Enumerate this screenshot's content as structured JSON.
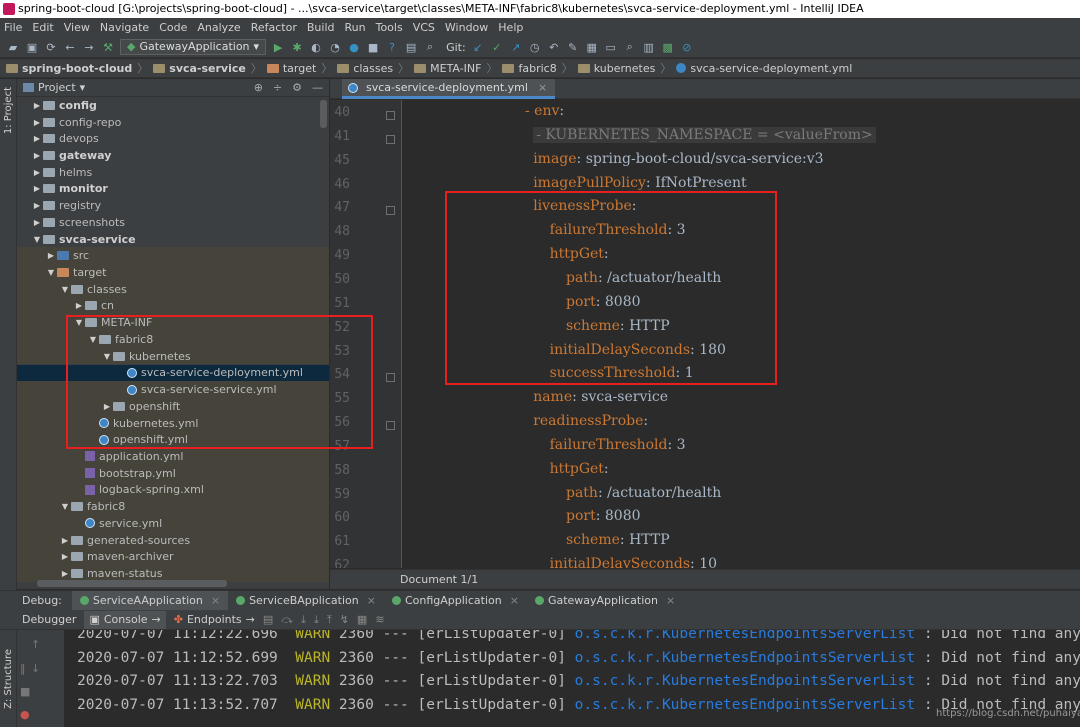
{
  "window": {
    "title": "spring-boot-cloud [G:\\projects\\spring-boot-cloud] - ...\\svca-service\\target\\classes\\META-INF\\fabric8\\kubernetes\\svca-service-deployment.yml - IntelliJ IDEA"
  },
  "menu": [
    "File",
    "Edit",
    "View",
    "Navigate",
    "Code",
    "Analyze",
    "Refactor",
    "Build",
    "Run",
    "Tools",
    "VCS",
    "Window",
    "Help"
  ],
  "toolbar": {
    "run_config": "GatewayApplication",
    "git_label": "Git:"
  },
  "breadcrumbs": [
    "spring-boot-cloud",
    "svca-service",
    "target",
    "classes",
    "META-INF",
    "fabric8",
    "kubernetes",
    "svca-service-deployment.yml"
  ],
  "side_strip": {
    "project": "1: Project",
    "structure": "Z: Structure"
  },
  "project_panel": {
    "title": "Project",
    "tree": [
      {
        "label": "config",
        "bold": true
      },
      {
        "label": "config-repo"
      },
      {
        "label": "devops"
      },
      {
        "label": "gateway",
        "bold": true
      },
      {
        "label": "helms"
      },
      {
        "label": "monitor",
        "bold": true
      },
      {
        "label": "registry"
      },
      {
        "label": "screenshots"
      },
      {
        "label": "svca-service",
        "bold": true
      },
      {
        "label": "src"
      },
      {
        "label": "target"
      },
      {
        "label": "classes"
      },
      {
        "label": "cn"
      },
      {
        "label": "META-INF"
      },
      {
        "label": "fabric8"
      },
      {
        "label": "kubernetes"
      },
      {
        "label": "svca-service-deployment.yml"
      },
      {
        "label": "svca-service-service.yml"
      },
      {
        "label": "openshift"
      },
      {
        "label": "kubernetes.yml"
      },
      {
        "label": "openshift.yml"
      },
      {
        "label": "application.yml"
      },
      {
        "label": "bootstrap.yml"
      },
      {
        "label": "logback-spring.xml"
      },
      {
        "label": "fabric8"
      },
      {
        "label": "service.yml"
      },
      {
        "label": "generated-sources"
      },
      {
        "label": "maven-archiver"
      },
      {
        "label": "maven-status"
      }
    ]
  },
  "editor": {
    "tab_label": "svca-service-deployment.yml",
    "line_numbers": [
      "40",
      "41",
      "45",
      "46",
      "47",
      "48",
      "49",
      "50",
      "51",
      "52",
      "53",
      "54",
      "55",
      "56",
      "57",
      "58",
      "59",
      "60",
      "61",
      "62"
    ],
    "lines": [
      {
        "key": "- env",
        "sep": ":",
        "val": ""
      },
      {
        "key": "",
        "sep": "",
        "val": "",
        "folded": "- KUBERNETES_NAMESPACE = <valueFrom>"
      },
      {
        "key": "image",
        "sep": ": ",
        "val": "spring-boot-cloud/svca-service:v3"
      },
      {
        "key": "imagePullPolicy",
        "sep": ": ",
        "val": "IfNotPresent"
      },
      {
        "key": "livenessProbe",
        "sep": ":",
        "val": ""
      },
      {
        "key": "failureThreshold",
        "sep": ": ",
        "val": "3"
      },
      {
        "key": "httpGet",
        "sep": ":",
        "val": ""
      },
      {
        "key": "path",
        "sep": ": ",
        "val": "/actuator/health"
      },
      {
        "key": "port",
        "sep": ": ",
        "val": "8080"
      },
      {
        "key": "scheme",
        "sep": ": ",
        "val": "HTTP"
      },
      {
        "key": "initialDelaySeconds",
        "sep": ": ",
        "val": "180"
      },
      {
        "key": "successThreshold",
        "sep": ": ",
        "val": "1"
      },
      {
        "key": "name",
        "sep": ": ",
        "val": "svca-service"
      },
      {
        "key": "readinessProbe",
        "sep": ":",
        "val": ""
      },
      {
        "key": "failureThreshold",
        "sep": ": ",
        "val": "3"
      },
      {
        "key": "httpGet",
        "sep": ":",
        "val": ""
      },
      {
        "key": "path",
        "sep": ": ",
        "val": "/actuator/health"
      },
      {
        "key": "port",
        "sep": ": ",
        "val": "8080"
      },
      {
        "key": "scheme",
        "sep": ": ",
        "val": "HTTP"
      },
      {
        "key": "initialDelaySeconds",
        "sep": ": ",
        "val": "10"
      }
    ],
    "status": "Document 1/1"
  },
  "debug": {
    "label": "Debug:",
    "tabs": [
      "ServiceAApplication",
      "ServiceBApplication",
      "ConfigApplication",
      "GatewayApplication"
    ],
    "sub_tabs": [
      "Debugger",
      "Console",
      "Endpoints"
    ],
    "log_lines": [
      {
        "time": "2020-07-07 11:12:22.696",
        "level": "WARN",
        "pid": "2360",
        "sep": "---",
        "thread": "[erListUpdater-0]",
        "cls": "o.s.c.k.r.KubernetesEndpointsServerList",
        "msg": ": Did not find any endpo"
      },
      {
        "time": "2020-07-07 11:12:52.699",
        "level": "WARN",
        "pid": "2360",
        "sep": "---",
        "thread": "[erListUpdater-0]",
        "cls": "o.s.c.k.r.KubernetesEndpointsServerList",
        "msg": ": Did not find any endpo"
      },
      {
        "time": "2020-07-07 11:13:22.703",
        "level": "WARN",
        "pid": "2360",
        "sep": "---",
        "thread": "[erListUpdater-0]",
        "cls": "o.s.c.k.r.KubernetesEndpointsServerList",
        "msg": ": Did not find any endpo"
      },
      {
        "time": "2020-07-07 11:13:52.707",
        "level": "WARN",
        "pid": "2360",
        "sep": "---",
        "thread": "[erListUpdater-0]",
        "cls": "o.s.c.k.r.KubernetesEndpointsServerList",
        "msg": ": Did not find any endpo"
      }
    ]
  },
  "watermark": "https://blog.csdn.net/puhaiyang",
  "colors": {
    "highlight_box": "#e81f1f",
    "yaml_key": "#cc7832",
    "warn": "#bbb529",
    "class_name": "#287bde"
  }
}
